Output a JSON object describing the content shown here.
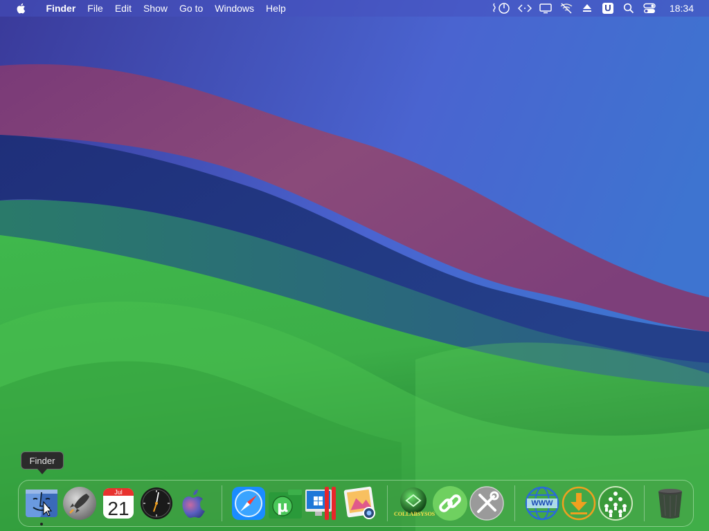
{
  "menubar": {
    "app_name": "Finder",
    "items": [
      "File",
      "Edit",
      "Show",
      "Go to",
      "Windows",
      "Help"
    ],
    "status_badge_letter": "U",
    "clock": "18:34"
  },
  "dock": {
    "tooltip": "Finder",
    "calendar": {
      "month": "Jul",
      "day": "21"
    },
    "collabsysos_label": "COLLABSYSOS",
    "www_label": "WWW"
  },
  "colors": {
    "menubar_bg": "#4650be",
    "dock_bg": "#46a046",
    "safari_blue": "#1a8cff",
    "link_green": "#6fd060",
    "download_orange": "#f0a020"
  }
}
